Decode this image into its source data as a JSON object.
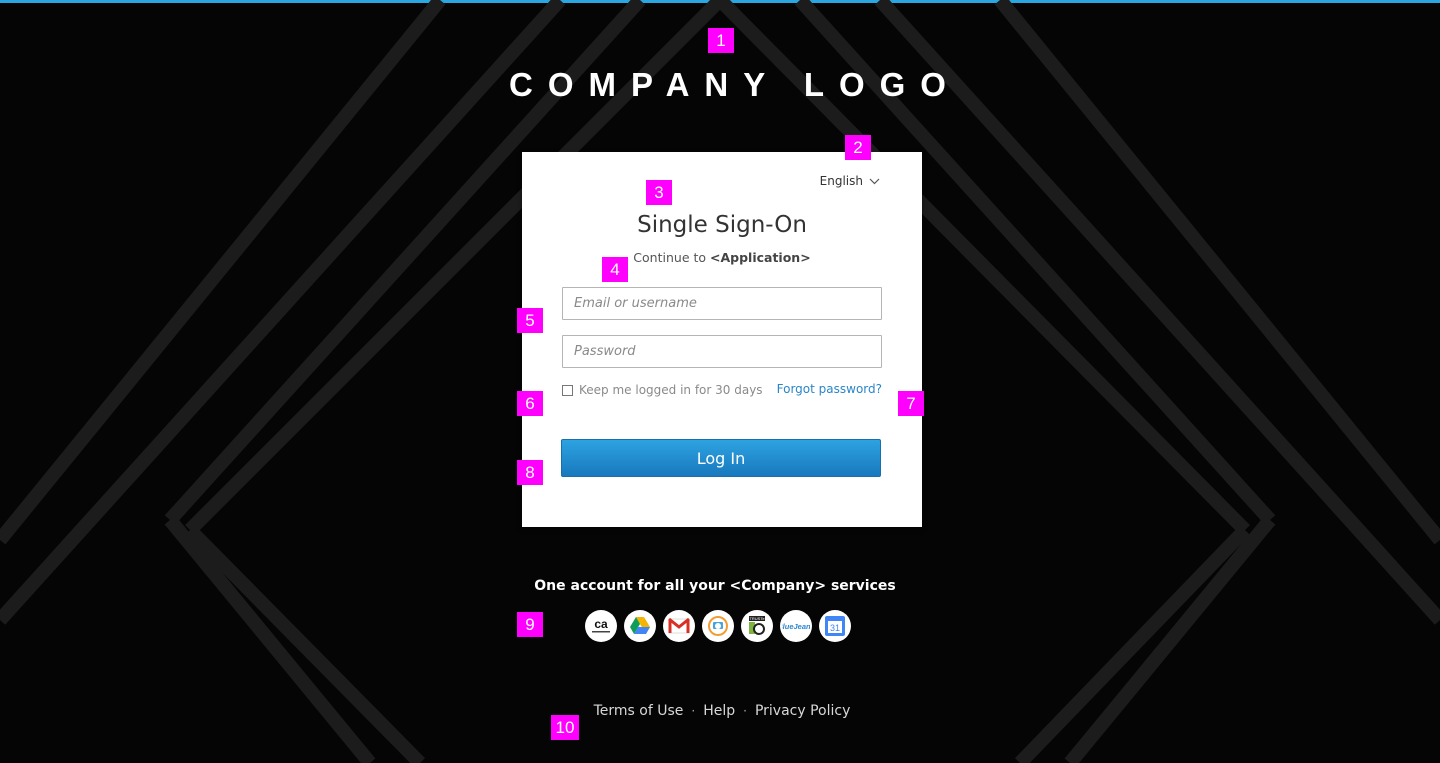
{
  "logo": {
    "text": "COMPANY LOGO"
  },
  "language": {
    "label": "English"
  },
  "login": {
    "title": "Single Sign-On",
    "continue_prefix": "Continue to ",
    "continue_app": "<Application>",
    "email_placeholder": "Email or username",
    "password_placeholder": "Password",
    "keep_label": "Keep me logged in for 30 days",
    "forgot_label": "Forgot password?",
    "button_label": "Log In"
  },
  "services": {
    "tagline": "One account for all your <Company> services",
    "icons": [
      "ca-technologies-icon",
      "google-drive-icon",
      "gmail-icon",
      "service-icon",
      "truste-icon",
      "bluejeans-icon",
      "google-calendar-icon"
    ],
    "calendar_day": "31"
  },
  "footer": {
    "terms": "Terms of Use",
    "help": "Help",
    "privacy": "Privacy Policy",
    "separator": "·"
  },
  "annotations": [
    "1",
    "2",
    "3",
    "4",
    "5",
    "6",
    "7",
    "8",
    "9",
    "10"
  ],
  "colors": {
    "accent": "#2aa7e0",
    "button": "#1a8fd4",
    "link": "#2a85c9",
    "annotation": "#ff00ff",
    "background": "#050505"
  }
}
